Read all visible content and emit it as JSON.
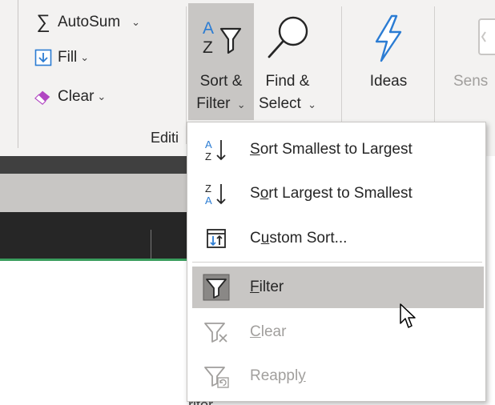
{
  "ribbon": {
    "autosum": {
      "label": "AutoSum",
      "symbol": "∑",
      "caret": "⌄"
    },
    "fill": {
      "label": "Fill",
      "caret": "⌄"
    },
    "clear": {
      "label": "Clear",
      "caret": "⌄"
    },
    "sort_filter": {
      "line1": "Sort &",
      "line2": "Filter",
      "caret": "⌄"
    },
    "find_select": {
      "line1": "Find &",
      "line2": "Select",
      "caret": "⌄"
    },
    "ideas": {
      "label": "Ideas"
    },
    "sensitivity": {
      "label": "Sens"
    },
    "group_label": "Editi"
  },
  "menu": {
    "items": [
      {
        "label_key": "S",
        "label_rest": "ort Smallest to Largest",
        "icon": "sort-ascending-icon",
        "state": "normal"
      },
      {
        "label_pre": "S",
        "label_key": "o",
        "label_rest": "rt Largest to Smallest",
        "icon": "sort-descending-icon",
        "state": "normal"
      },
      {
        "label_pre": "C",
        "label_key": "u",
        "label_rest": "stom Sort...",
        "icon": "custom-sort-icon",
        "state": "normal"
      },
      {
        "label_key": "F",
        "label_rest": "ilter",
        "icon": "filter-icon",
        "state": "hover"
      },
      {
        "label_key": "C",
        "label_rest": "lear",
        "icon": "clear-filter-icon",
        "state": "disabled"
      },
      {
        "label_pre": "Reappl",
        "label_key": "y",
        "icon": "reapply-filter-icon",
        "state": "disabled"
      }
    ]
  },
  "sheet": {
    "cut_text": "ritor"
  },
  "colors": {
    "ribbon_bg": "#f3f2f1",
    "accent_blue": "#2b7cd3",
    "selection_gray": "#c8c6c4",
    "excel_green": "#3a9d5d"
  }
}
